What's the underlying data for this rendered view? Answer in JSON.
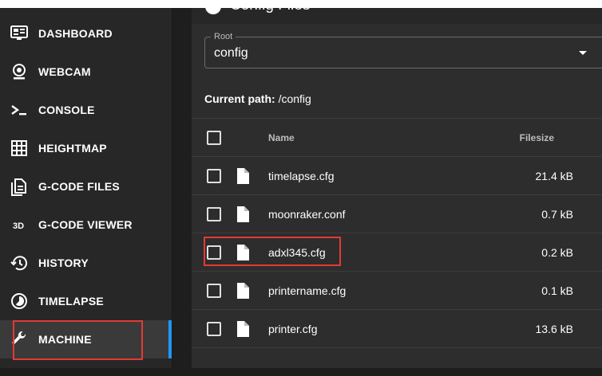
{
  "sidebar": {
    "items": [
      {
        "label": "DASHBOARD",
        "icon": "monitor-dashboard-icon"
      },
      {
        "label": "WEBCAM",
        "icon": "webcam-icon"
      },
      {
        "label": "CONSOLE",
        "icon": "console-icon"
      },
      {
        "label": "HEIGHTMAP",
        "icon": "grid-icon"
      },
      {
        "label": "G-CODE FILES",
        "icon": "file-document-multiple-icon"
      },
      {
        "label": "G-CODE VIEWER",
        "icon": "3d-icon"
      },
      {
        "label": "HISTORY",
        "icon": "history-icon"
      },
      {
        "label": "TIMELAPSE",
        "icon": "timelapse-icon"
      },
      {
        "label": "MACHINE",
        "icon": "wrench-icon",
        "active": true
      }
    ],
    "accent": "#2196f3"
  },
  "main": {
    "title": "Config Files",
    "root": {
      "legend": "Root",
      "value": "config"
    },
    "current_path": {
      "label": "Current path:",
      "value": "/config"
    },
    "table": {
      "columns": [
        "Name",
        "Filesize"
      ],
      "rows": [
        {
          "name": "timelapse.cfg",
          "size": "21.4 kB"
        },
        {
          "name": "moonraker.conf",
          "size": "0.7 kB"
        },
        {
          "name": "adxl345.cfg",
          "size": "0.2 kB"
        },
        {
          "name": "printername.cfg",
          "size": "0.1 kB"
        },
        {
          "name": "printer.cfg",
          "size": "13.6 kB"
        }
      ]
    }
  },
  "highlight_color": "#e53935"
}
